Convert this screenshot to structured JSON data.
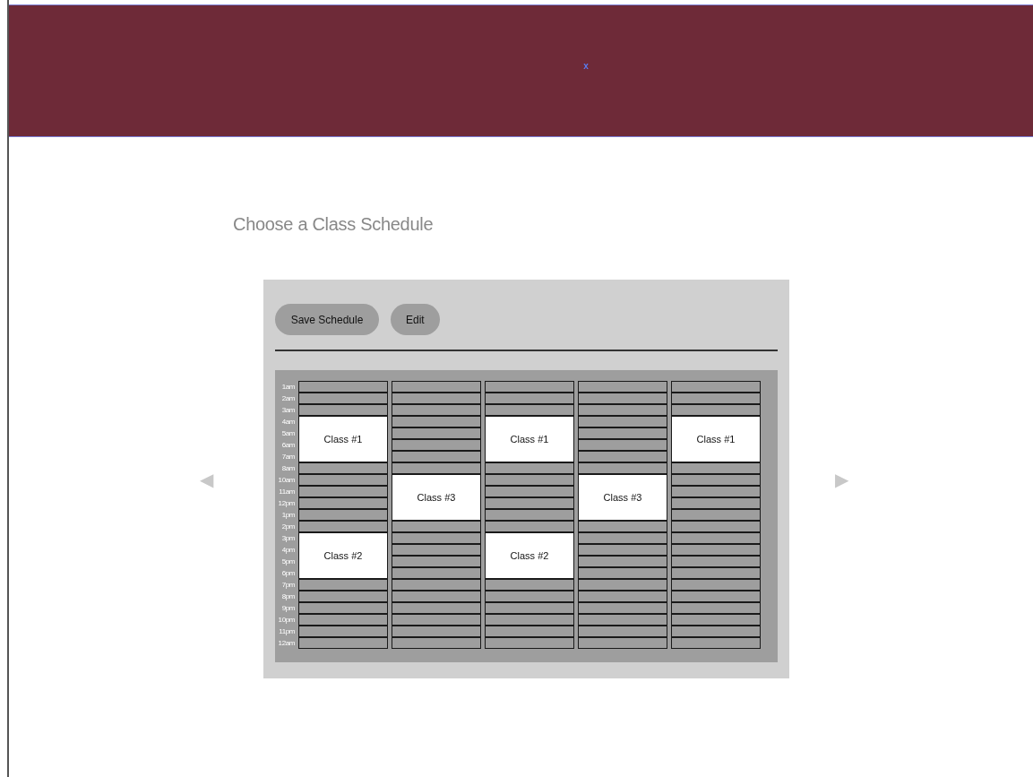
{
  "header": {
    "icon_text": "x"
  },
  "title": "Choose a Class Schedule",
  "toolbar": {
    "buttons": [
      "Save Schedule",
      "Edit"
    ]
  },
  "nav": {
    "prev": "◀",
    "next": "▶"
  },
  "hours": [
    "1am",
    "2am",
    "3am",
    "4am",
    "5am",
    "6am",
    "7am",
    "8am",
    "10am",
    "11am",
    "12pm",
    "1pm",
    "2pm",
    "3pm",
    "4pm",
    "5pm",
    "6pm",
    "7pm",
    "8pm",
    "9pm",
    "10pm",
    "11pm",
    "12am"
  ],
  "columns": [
    {
      "cells": [
        {
          "kind": "slot"
        },
        {
          "kind": "slot"
        },
        {
          "kind": "slot"
        },
        {
          "kind": "class",
          "label": "Class #1"
        },
        {
          "kind": "slot"
        },
        {
          "kind": "slot"
        },
        {
          "kind": "slot"
        },
        {
          "kind": "slot"
        },
        {
          "kind": "slot"
        },
        {
          "kind": "slot"
        },
        {
          "kind": "class",
          "label": "Class #2"
        },
        {
          "kind": "slot"
        },
        {
          "kind": "slot"
        },
        {
          "kind": "slot"
        },
        {
          "kind": "slot"
        },
        {
          "kind": "slot"
        },
        {
          "kind": "slot"
        }
      ]
    },
    {
      "cells": [
        {
          "kind": "slot"
        },
        {
          "kind": "slot"
        },
        {
          "kind": "slot"
        },
        {
          "kind": "slot"
        },
        {
          "kind": "slot"
        },
        {
          "kind": "slot"
        },
        {
          "kind": "slot"
        },
        {
          "kind": "slot"
        },
        {
          "kind": "class",
          "label": "Class #3"
        },
        {
          "kind": "slot"
        },
        {
          "kind": "slot"
        },
        {
          "kind": "slot"
        },
        {
          "kind": "slot"
        },
        {
          "kind": "slot"
        },
        {
          "kind": "slot"
        },
        {
          "kind": "slot"
        },
        {
          "kind": "slot"
        },
        {
          "kind": "slot"
        },
        {
          "kind": "slot"
        },
        {
          "kind": "slot"
        }
      ]
    },
    {
      "cells": [
        {
          "kind": "slot"
        },
        {
          "kind": "slot"
        },
        {
          "kind": "slot"
        },
        {
          "kind": "class",
          "label": "Class #1"
        },
        {
          "kind": "slot"
        },
        {
          "kind": "slot"
        },
        {
          "kind": "slot"
        },
        {
          "kind": "slot"
        },
        {
          "kind": "slot"
        },
        {
          "kind": "slot"
        },
        {
          "kind": "class",
          "label": "Class #2"
        },
        {
          "kind": "slot"
        },
        {
          "kind": "slot"
        },
        {
          "kind": "slot"
        },
        {
          "kind": "slot"
        },
        {
          "kind": "slot"
        },
        {
          "kind": "slot"
        }
      ]
    },
    {
      "cells": [
        {
          "kind": "slot"
        },
        {
          "kind": "slot"
        },
        {
          "kind": "slot"
        },
        {
          "kind": "slot"
        },
        {
          "kind": "slot"
        },
        {
          "kind": "slot"
        },
        {
          "kind": "slot"
        },
        {
          "kind": "slot"
        },
        {
          "kind": "class",
          "label": "Class #3"
        },
        {
          "kind": "slot"
        },
        {
          "kind": "slot"
        },
        {
          "kind": "slot"
        },
        {
          "kind": "slot"
        },
        {
          "kind": "slot"
        },
        {
          "kind": "slot"
        },
        {
          "kind": "slot"
        },
        {
          "kind": "slot"
        },
        {
          "kind": "slot"
        },
        {
          "kind": "slot"
        },
        {
          "kind": "slot"
        }
      ]
    },
    {
      "cells": [
        {
          "kind": "slot"
        },
        {
          "kind": "slot"
        },
        {
          "kind": "slot"
        },
        {
          "kind": "class",
          "label": "Class #1"
        },
        {
          "kind": "slot"
        },
        {
          "kind": "slot"
        },
        {
          "kind": "slot"
        },
        {
          "kind": "slot"
        },
        {
          "kind": "slot"
        },
        {
          "kind": "slot"
        },
        {
          "kind": "slot"
        },
        {
          "kind": "slot"
        },
        {
          "kind": "slot"
        },
        {
          "kind": "slot"
        },
        {
          "kind": "slot"
        },
        {
          "kind": "slot"
        },
        {
          "kind": "slot"
        },
        {
          "kind": "slot"
        },
        {
          "kind": "slot"
        },
        {
          "kind": "slot"
        }
      ]
    }
  ]
}
